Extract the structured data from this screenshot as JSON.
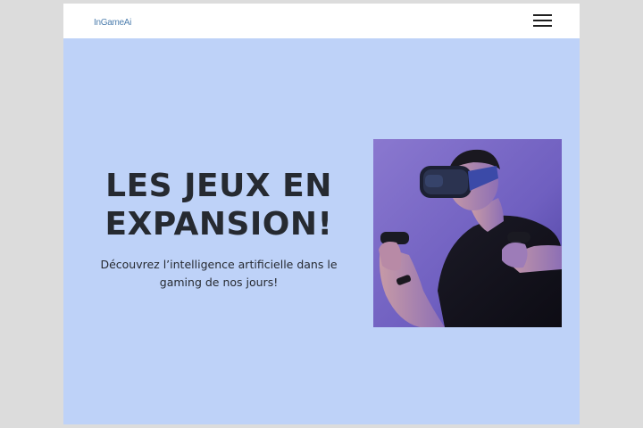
{
  "header": {
    "logo_text": "InGameAi",
    "menu_icon": "hamburger-menu-icon"
  },
  "hero": {
    "title": "LES JEUX EN EXPANSION!",
    "subtitle": "Découvrez l’intelligence artificielle dans le gaming de nos jours!",
    "image": "vr-gamer-photo"
  },
  "colors": {
    "page_background": "#dcdcdc",
    "hero_background": "#bed2f8",
    "header_background": "#ffffff",
    "title_color": "#262a31",
    "logo_color": "#4f7fae"
  }
}
